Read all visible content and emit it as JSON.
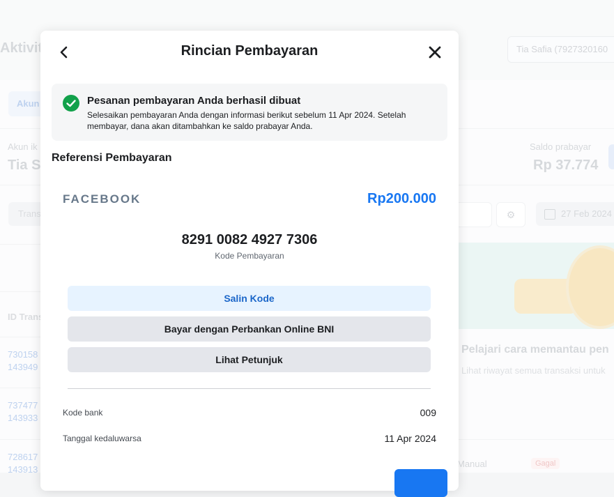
{
  "background": {
    "page_title": "Aktivita",
    "account_selector": "Tia Safia (7927320160",
    "tab_label": "Akun",
    "account_label": "Akun ik",
    "account_name": "Tia S",
    "balance_label": "Saldo prabayar",
    "balance_value": "Rp 37.774",
    "search_placeholder": "Trans",
    "date_filter": "27 Feb 2024",
    "column_id": "ID Trans",
    "rows": [
      {
        "a": "730158",
        "b": "143949"
      },
      {
        "a": "737477",
        "b": "143933"
      },
      {
        "a": "728617",
        "b": "143913"
      }
    ],
    "learn_title": "Pelajari cara memantau pen",
    "learn_subtitle": "Lihat riwayat semua transaksi untuk",
    "method_manual": "Manual",
    "status_failed": "Gagal"
  },
  "modal": {
    "title": "Rincian Pembayaran",
    "alert": {
      "title": "Pesanan pembayaran Anda berhasil dibuat",
      "body": "Selesaikan pembayaran Anda dengan informasi berikut sebelum 11 Apr 2024. Setelah membayar, dana akan ditambahkan ke saldo prabayar Anda."
    },
    "reference_heading": "Referensi Pembayaran",
    "brand": "FACEBOOK",
    "amount": "Rp200.000",
    "payment_code": "8291 0082 4927 7306",
    "payment_code_label": "Kode Pembayaran",
    "buttons": {
      "copy": "Salin Kode",
      "pay_bni": "Bayar dengan Perbankan Online BNI",
      "guide": "Lihat Petunjuk"
    },
    "details": [
      {
        "label": "Kode bank",
        "value": "009"
      },
      {
        "label": "Tanggal kedaluwarsa",
        "value": "11 Apr 2024"
      }
    ]
  },
  "colors": {
    "accent": "#1877f2",
    "success": "#12a14b",
    "copy_button_bg": "#e7f3ff",
    "secondary_button_bg": "#e4e6eb"
  }
}
